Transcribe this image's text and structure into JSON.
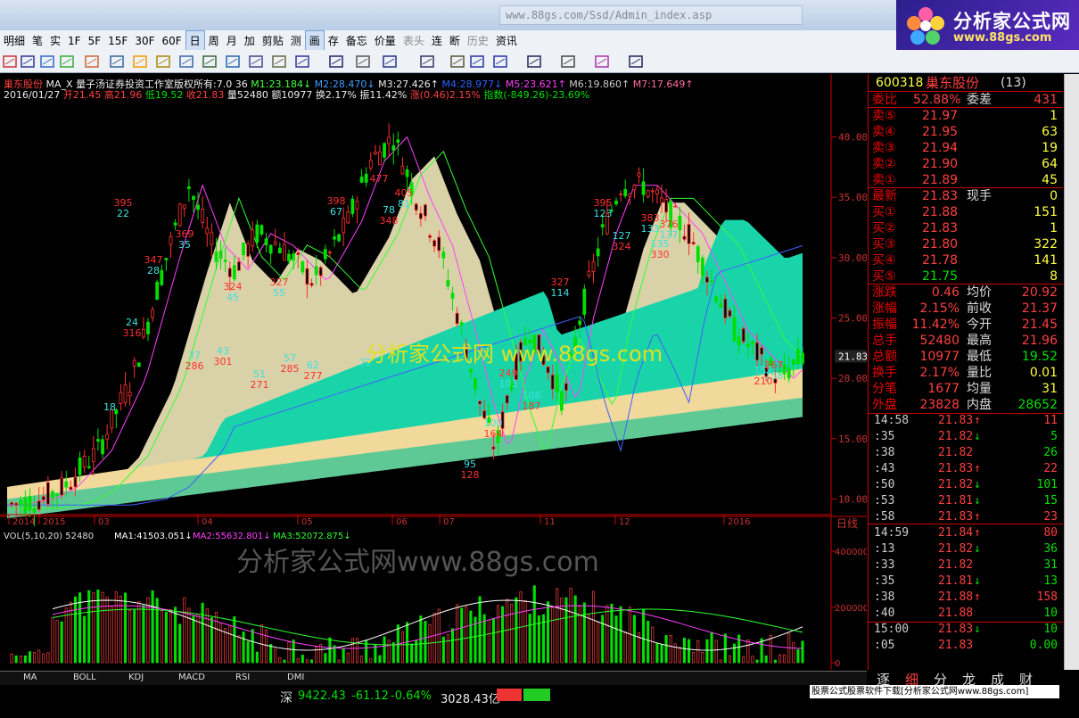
{
  "app": {
    "address": "www.88gs.com/Ssd/Admin_index.asp",
    "logo_title": "分析家公式网",
    "logo_url": "www.88gs.com"
  },
  "menu": [
    "明细",
    "笔",
    "实",
    "1F",
    "5F",
    "15F",
    "30F",
    "60F",
    "日",
    "周",
    "月",
    "加",
    "剪贴",
    "测",
    "画",
    "存",
    "备忘",
    "价量",
    "表头",
    "连",
    "断",
    "历史",
    "资讯"
  ],
  "menu_active": [
    "日",
    "画"
  ],
  "menu_dim": [
    "表头",
    "历史"
  ],
  "toolbar_icons": [
    "grid-icon",
    "list-icon",
    "copy-icon",
    "cube-icon",
    "chart-icon",
    "layers-icon",
    "warning-icon",
    "gear-icon",
    "trend-icon",
    "table-icon",
    "line-icon",
    "window-icon",
    "doc-icon",
    "pen-icon",
    "draw-line-icon",
    "dots-icon",
    "fan-icon",
    "channel-icon",
    "parallel-icon",
    "rect-icon",
    "circle-icon",
    "text-icon",
    "copy2-icon",
    "palette-icon",
    "save-icon"
  ],
  "header": {
    "line1": {
      "name": "巢东股份",
      "indicator": "MA_X",
      "note": "量子汤证券投资工作室版权所有:7.0 36",
      "m1": "M1:23.184↓",
      "m2": "M2:28.470↓",
      "m3": "M3:27.426↑",
      "m4": "M4:28.977↓",
      "m5": "M5:23.621↑",
      "m6": "M6:19.860↑",
      "m7": "M7:17.649↑"
    },
    "line2": {
      "date": "2016/01/27",
      "open": "开21.45",
      "high": "高21.96",
      "low": "低19.52",
      "close": "收21.83",
      "vol": "量52480",
      "amt": "额10977",
      "turn": "换2.17%",
      "amp": "振11.42%",
      "chg": "涨(0.46)2.15%",
      "idx": "指数(-849.26)-23.69%"
    }
  },
  "chart_data": {
    "type": "candlestick",
    "price_axis": [
      "40.00",
      "35.00",
      "30.00",
      "25.00",
      "20.00",
      "15.00",
      "10.00"
    ],
    "price_range": [
      9,
      43
    ],
    "current_price_label": "21.83",
    "x_labels": [
      "2014",
      "2015",
      "03",
      "04",
      "05",
      "06",
      "07",
      "11",
      "12",
      "2016"
    ],
    "period_label": "日线",
    "peak_labels": [
      {
        "p": "395",
        "v": "22"
      },
      {
        "p": "347",
        "v": "28"
      },
      {
        "p": "369",
        "v": "35"
      },
      {
        "p": "324",
        "v": "45"
      },
      {
        "p": "327",
        "v": "55"
      },
      {
        "p": "398",
        "v": "67"
      },
      {
        "p": "477",
        "v": ""
      },
      {
        "p": "405",
        "v": "81"
      },
      {
        "p": "395",
        "v": "123"
      },
      {
        "p": "327",
        "v": "114"
      },
      {
        "p": "383",
        "v": "133"
      },
      {
        "p": "376",
        "v": "137"
      },
      {
        "p": "249",
        "v": "103"
      },
      {
        "p": "267",
        "v": "158"
      }
    ],
    "trough_labels": [
      {
        "v": "24",
        "p": "316"
      },
      {
        "v": "37",
        "p": "286"
      },
      {
        "v": "43",
        "p": "301"
      },
      {
        "v": "51",
        "p": "271"
      },
      {
        "v": "57",
        "p": "285"
      },
      {
        "v": "62",
        "p": "277"
      },
      {
        "v": "72",
        "p": ""
      },
      {
        "v": "78",
        "p": "348"
      },
      {
        "v": "127",
        "p": "324"
      },
      {
        "v": "135",
        "p": "330"
      },
      {
        "v": "100",
        "p": "164"
      },
      {
        "v": "95",
        "p": "128"
      },
      {
        "v": "108",
        "p": "187"
      },
      {
        "v": "157",
        "p": "210"
      },
      {
        "v": "18",
        "p": ""
      }
    ],
    "watermark": "分析家公式网  www.88gs.com",
    "vol_header": {
      "label": "VOL(5,10,20)",
      "v": "52480",
      "ma1": "MA1:41503.051↓",
      "ma2": "MA2:55632.801↓",
      "ma3": "MA3:52072.875↓"
    },
    "vol_axis": [
      "400000",
      "200000",
      "0"
    ],
    "vol_watermark": "分析家公式网www.88gs.com"
  },
  "quote": {
    "code": "600318",
    "name": "巢东股份",
    "count": "(13)",
    "wb_label": "委比",
    "wb": "52.88%",
    "wc_label": "委差",
    "wc": "431",
    "asks": [
      {
        "l": "卖⑤",
        "p": "21.97",
        "v": "1"
      },
      {
        "l": "卖④",
        "p": "21.95",
        "v": "63"
      },
      {
        "l": "卖③",
        "p": "21.94",
        "v": "19"
      },
      {
        "l": "卖②",
        "p": "21.90",
        "v": "64"
      },
      {
        "l": "卖①",
        "p": "21.89",
        "v": "45"
      }
    ],
    "last": {
      "l": "最新",
      "p": "21.83",
      "l2": "现手",
      "v": "0"
    },
    "bids": [
      {
        "l": "买①",
        "p": "21.88",
        "v": "151"
      },
      {
        "l": "买②",
        "p": "21.83",
        "v": "1"
      },
      {
        "l": "买③",
        "p": "21.80",
        "v": "322"
      },
      {
        "l": "买④",
        "p": "21.78",
        "v": "141"
      },
      {
        "l": "买⑤",
        "p": "21.75",
        "v": "8"
      }
    ],
    "stats": [
      {
        "l": "涨跌",
        "p": "0.46",
        "l2": "均价",
        "v": "20.92"
      },
      {
        "l": "涨幅",
        "p": "2.15%",
        "l2": "前收",
        "v": "21.37"
      },
      {
        "l": "振幅",
        "p": "11.42%",
        "l2": "今开",
        "v": "21.45"
      },
      {
        "l": "总手",
        "p": "52480",
        "l2": "最高",
        "v": "21.96"
      },
      {
        "l": "总额",
        "p": "10977",
        "l2": "最低",
        "v": "19.52"
      },
      {
        "l": "换手",
        "p": "2.17%",
        "l2": "量比",
        "v": "0.01"
      },
      {
        "l": "分笔",
        "p": "1677",
        "l2": "均量",
        "v": "31"
      },
      {
        "l": "外盘",
        "p": "23828",
        "l2": "内盘",
        "v": "28652"
      }
    ],
    "ticks": [
      {
        "t": "14:58",
        "p": "21.83",
        "a": "up",
        "v": "11"
      },
      {
        "t": ":35",
        "p": "21.82",
        "a": "dn",
        "v": "5"
      },
      {
        "t": ":38",
        "p": "21.82",
        "a": "",
        "v": "26"
      },
      {
        "t": ":43",
        "p": "21.83",
        "a": "up",
        "v": "22"
      },
      {
        "t": ":50",
        "p": "21.82",
        "a": "dn",
        "v": "101"
      },
      {
        "t": ":53",
        "p": "21.81",
        "a": "dn",
        "v": "15"
      },
      {
        "t": ":58",
        "p": "21.83",
        "a": "up",
        "v": "23"
      },
      {
        "t": "14:59",
        "p": "21.84",
        "a": "up",
        "v": "80"
      },
      {
        "t": ":13",
        "p": "21.82",
        "a": "dn",
        "v": "36"
      },
      {
        "t": ":33",
        "p": "21.82",
        "a": "",
        "v": "31"
      },
      {
        "t": ":35",
        "p": "21.81",
        "a": "dn",
        "v": "13"
      },
      {
        "t": ":38",
        "p": "21.88",
        "a": "up",
        "v": "158"
      },
      {
        "t": ":40",
        "p": "21.88",
        "a": "",
        "v": "10"
      },
      {
        "t": "15:00",
        "p": "21.83",
        "a": "dn",
        "v": "10"
      },
      {
        "t": ":05",
        "p": "21.83",
        "a": "",
        "v": "0.00"
      }
    ],
    "tabs": [
      "逐",
      "细",
      "分",
      "龙",
      "成",
      "财"
    ]
  },
  "bottom_tabs": [
    "MA",
    "BOLL",
    "KDJ",
    "MACD",
    "RSI",
    "DMI"
  ],
  "status": {
    "index_name": "深",
    "index_val": "9422.43",
    "index_chg": "-61.12",
    "index_pct": "-0.64%",
    "index_amt": "3028.43亿",
    "ad": "股票公式股票软件下载[分析家公式网www.88gs.com]"
  }
}
